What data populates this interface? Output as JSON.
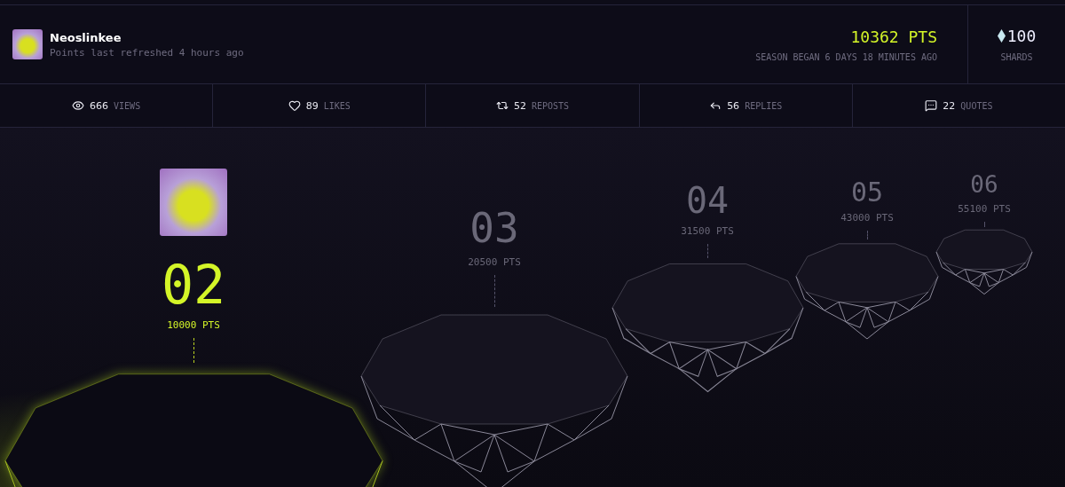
{
  "profile": {
    "name": "Neoslinkee",
    "subtitle": "Points last refreshed 4 hours ago"
  },
  "points": {
    "value": "10362 PTS",
    "caption": "SEASON BEGAN 6 DAYS 18 MINUTES AGO"
  },
  "shards": {
    "value": "100",
    "caption": "SHARDS"
  },
  "stats": [
    {
      "kind": "views",
      "count": "666",
      "label": "VIEWS"
    },
    {
      "kind": "likes",
      "count": "89",
      "label": "LIKES"
    },
    {
      "kind": "reposts",
      "count": "52",
      "label": "REPOSTS"
    },
    {
      "kind": "replies",
      "count": "56",
      "label": "REPLIES"
    },
    {
      "kind": "quotes",
      "count": "22",
      "label": "QUOTES"
    }
  ],
  "levels": [
    {
      "number": "02",
      "points": "10000 PTS",
      "selected": true
    },
    {
      "number": "03",
      "points": "20500 PTS",
      "selected": false
    },
    {
      "number": "04",
      "points": "31500 PTS",
      "selected": false
    },
    {
      "number": "05",
      "points": "43000 PTS",
      "selected": false
    },
    {
      "number": "06",
      "points": "55100 PTS",
      "selected": false
    }
  ]
}
